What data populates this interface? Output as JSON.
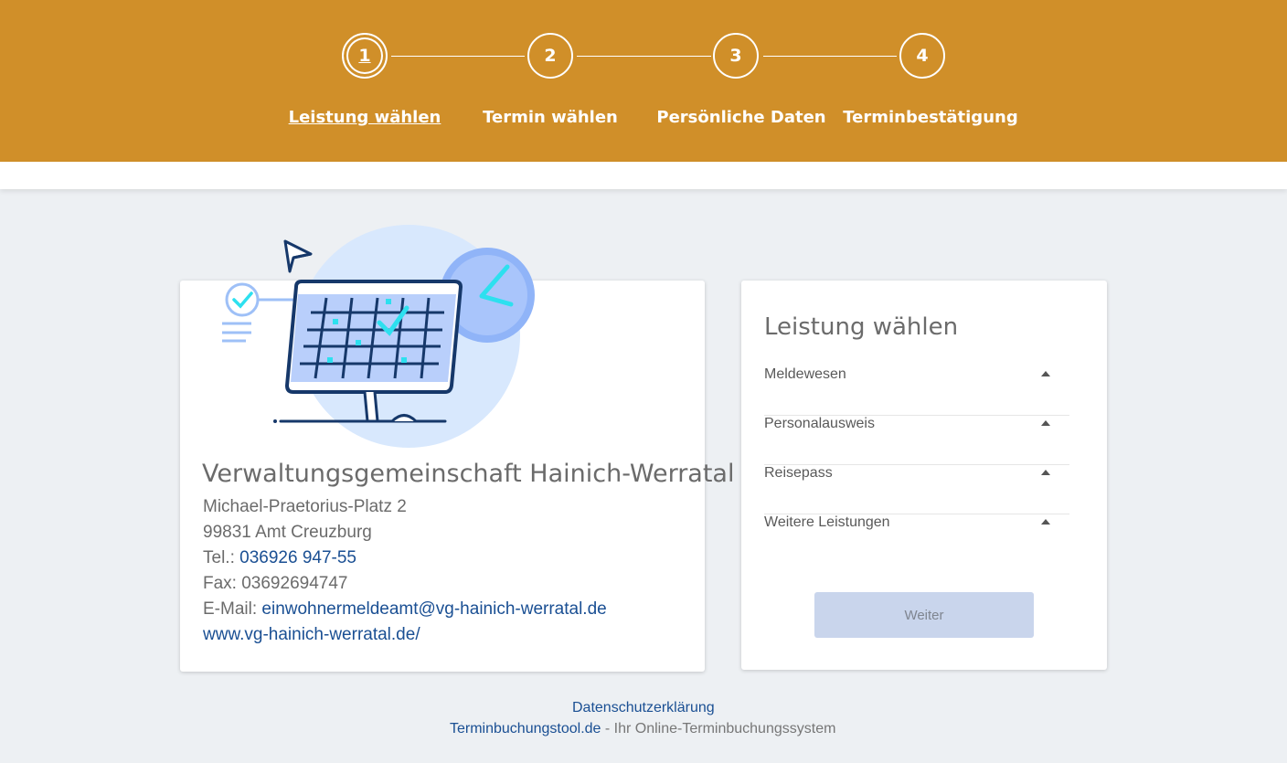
{
  "stepper": {
    "steps": [
      {
        "number": "1",
        "label": "Leistung wählen"
      },
      {
        "number": "2",
        "label": "Termin wählen"
      },
      {
        "number": "3",
        "label": "Persönliche Daten"
      },
      {
        "number": "4",
        "label": "Terminbestätigung"
      }
    ],
    "active_step": 1
  },
  "office": {
    "name": "Verwaltungsgemeinschaft Hainich-Werratal",
    "street": "Michael-Praetorius-Platz 2",
    "city": "99831 Amt Creuzburg",
    "tel_label": "Tel.:",
    "tel": "036926 947-55",
    "fax": "Fax: 03692694747",
    "email_label": "E-Mail:",
    "email": "einwohnermeldeamt@vg-hainich-werratal.de",
    "website": "www.vg-hainich-werratal.de/"
  },
  "services": {
    "title": "Leistung wählen",
    "items": [
      "Meldewesen",
      "Personalausweis",
      "Reisepass",
      "Weitere Leistungen"
    ],
    "next_button": "Weiter"
  },
  "footer": {
    "privacy": "Datenschutzerklärung",
    "tool_link": "Terminbuchungstool.de",
    "tool_suffix": " - Ihr Online-Terminbuchungssystem"
  },
  "colors": {
    "header": "#d08f29",
    "link": "#1a4f93",
    "background": "#edf0f3",
    "button_disabled": "#c9d5ec"
  }
}
